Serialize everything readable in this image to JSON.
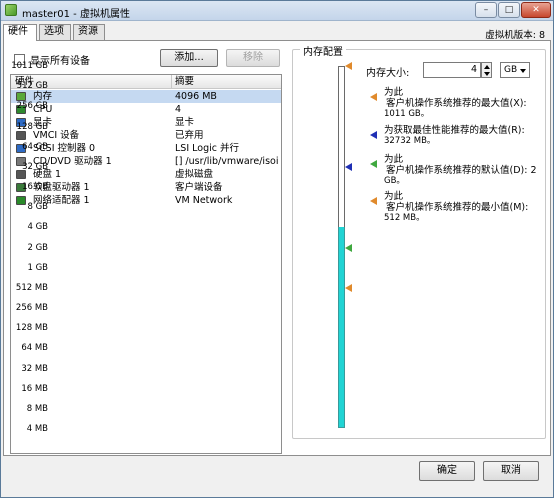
{
  "window": {
    "title": "master01 - 虚拟机属性",
    "controls": {
      "minimize": "–",
      "maximize": "□",
      "close": "✕"
    }
  },
  "tabs": [
    {
      "label": "硬件",
      "active": true
    },
    {
      "label": "选项",
      "active": false
    },
    {
      "label": "资源",
      "active": false
    }
  ],
  "version_label": "虚拟机版本: 8",
  "hardware_panel": {
    "show_all_devices_label": "显示所有设备",
    "add_button": "添加...",
    "remove_button": "移除",
    "columns": {
      "hardware": "硬件",
      "summary": "摘要"
    },
    "rows": [
      {
        "name": "内存",
        "summary": "4096 MB",
        "icon": "memory-icon",
        "selected": true
      },
      {
        "name": "CPU",
        "summary": "4",
        "icon": "cpu-icon",
        "selected": false
      },
      {
        "name": "显卡",
        "summary": "显卡",
        "icon": "display-icon",
        "selected": false
      },
      {
        "name": "VMCI 设备",
        "summary": "已弃用",
        "icon": "vmci-icon",
        "selected": false
      },
      {
        "name": "SCSI 控制器 0",
        "summary": "LSI Logic 并行",
        "icon": "scsi-icon",
        "selected": false
      },
      {
        "name": "CD/DVD 驱动器 1",
        "summary": "[] /usr/lib/vmware/isoi...",
        "icon": "cdrom-icon",
        "selected": false
      },
      {
        "name": "硬盘 1",
        "summary": "虚拟磁盘",
        "icon": "harddisk-icon",
        "selected": false
      },
      {
        "name": "软盘驱动器 1",
        "summary": "客户端设备",
        "icon": "floppy-icon",
        "selected": false
      },
      {
        "name": "网络适配器 1",
        "summary": "VM Network",
        "icon": "network-icon",
        "selected": false
      }
    ]
  },
  "memory_config": {
    "legend": "内存配置",
    "size_label": "内存大小:",
    "size_value": "4",
    "unit": "GB",
    "scale_ticks": [
      "1011 GB",
      "512 GB",
      "256 GB",
      "128 GB",
      "64 GB",
      "32 GB",
      "16 GB",
      "8 GB",
      "4 GB",
      "2 GB",
      "1 GB",
      "512 MB",
      "256 MB",
      "128 MB",
      "64 MB",
      "32 MB",
      "16 MB",
      "8 MB",
      "4 MB"
    ],
    "recommendations": [
      {
        "line1": "为此",
        "line2": "客户机操作系统推荐的最大值(X):",
        "value": "1011 GB。",
        "color": "#e08a2c",
        "marker": "orange-marker-icon"
      },
      {
        "line1": "为获取最佳性能推荐的最大值(R):",
        "line2": "",
        "value": "32732 MB。",
        "color": "#1f2fb4",
        "marker": "blue-marker-icon"
      },
      {
        "line1": "为此",
        "line2": "客户机操作系统推荐的默认值(D): 2",
        "value": "GB。",
        "color": "#3fa83f",
        "marker": "green-marker-icon"
      },
      {
        "line1": "为此",
        "line2": "客户机操作系统推荐的最小值(M):",
        "value": "512 MB。",
        "color": "#e08a2c",
        "marker": "orange-marker-icon"
      }
    ]
  },
  "footer": {
    "ok": "确定",
    "cancel": "取消"
  }
}
